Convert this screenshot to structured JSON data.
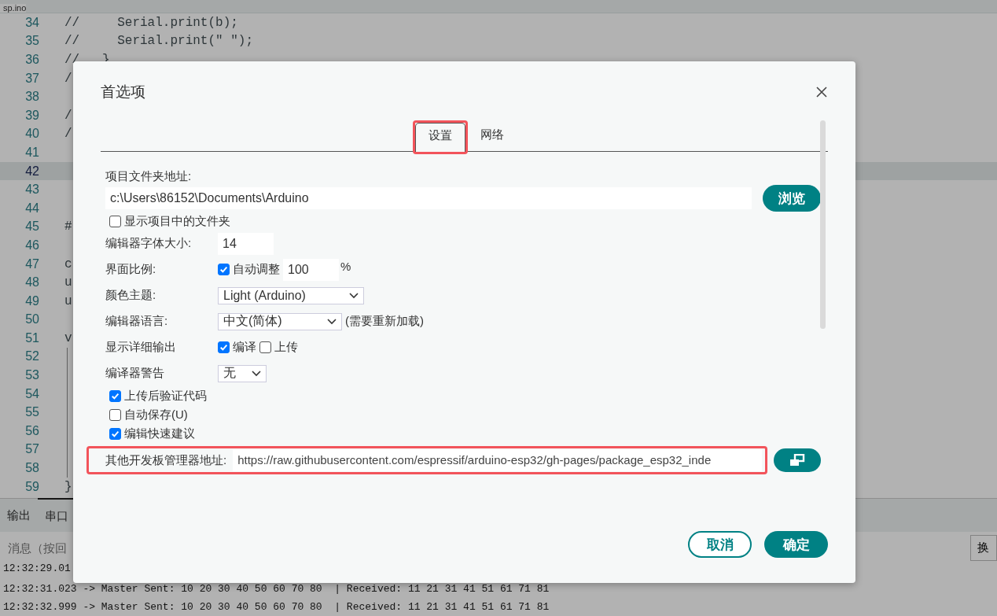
{
  "editor": {
    "file_tab": "sp.ino",
    "lines": [
      {
        "number": "34",
        "code": "//     Serial.print(b);",
        "current": false,
        "guide": false
      },
      {
        "number": "35",
        "code": "//     Serial.print(\" \");",
        "current": false,
        "guide": false
      },
      {
        "number": "36",
        "code": "//   }",
        "current": false,
        "guide": false
      },
      {
        "number": "37",
        "code": "/",
        "current": false,
        "guide": false
      },
      {
        "number": "38",
        "current": false,
        "guide": false
      },
      {
        "number": "39",
        "code": "/",
        "current": false,
        "guide": false
      },
      {
        "number": "40",
        "code": "/",
        "current": false,
        "guide": false
      },
      {
        "number": "41",
        "current": false,
        "guide": false
      },
      {
        "number": "42",
        "current": true,
        "guide": false
      },
      {
        "number": "43",
        "current": false,
        "guide": false
      },
      {
        "number": "44",
        "current": false,
        "guide": false
      },
      {
        "number": "45",
        "code": "#",
        "current": false,
        "guide": false
      },
      {
        "number": "46",
        "current": false,
        "guide": false
      },
      {
        "number": "47",
        "code": "c",
        "current": false,
        "guide": false
      },
      {
        "number": "48",
        "code": "u",
        "current": false,
        "guide": false
      },
      {
        "number": "49",
        "code": "u",
        "current": false,
        "guide": false
      },
      {
        "number": "50",
        "current": false,
        "guide": false
      },
      {
        "number": "51",
        "code": "v",
        "current": false,
        "guide": false
      },
      {
        "number": "52",
        "current": false,
        "guide": true
      },
      {
        "number": "53",
        "current": false,
        "guide": true
      },
      {
        "number": "54",
        "current": false,
        "guide": true
      },
      {
        "number": "55",
        "current": false,
        "guide": true
      },
      {
        "number": "56",
        "current": false,
        "guide": true
      },
      {
        "number": "57",
        "current": false,
        "guide": true
      },
      {
        "number": "58",
        "current": false,
        "guide": true
      },
      {
        "number": "59",
        "code": "}",
        "current": false,
        "guide": false
      }
    ]
  },
  "bottom_panel": {
    "tabs": [
      {
        "label": "输出",
        "selected": false
      },
      {
        "label": "串口",
        "selected": true
      }
    ],
    "message_field": {
      "placeholder": "消息（按回"
    },
    "line_ending": "换",
    "console": [
      "12:32:29.01",
      "12:32:31.023 -> Master Sent: 10 20 30 40 50 60 70 80  | Received: 11 21 31 41 51 61 71 81",
      "12:32:32.999 -> Master Sent: 10 20 30 40 50 60 70 80  | Received: 11 21 31 41 51 61 71 81"
    ]
  },
  "dialog": {
    "title": "首选项",
    "tabs": [
      {
        "label": "设置",
        "selected": true,
        "highlighted": true
      },
      {
        "label": "网络",
        "selected": false,
        "highlighted": false
      }
    ],
    "sketchbook": {
      "label": "项目文件夹地址:",
      "value": "c:\\Users\\86152\\Documents\\Arduino",
      "button": "浏览"
    },
    "show_files": {
      "label": "显示项目中的文件夹",
      "checked": false
    },
    "font_size": {
      "label": "编辑器字体大小:",
      "value": "14"
    },
    "scale": {
      "label": "界面比例:",
      "auto": {
        "label": "自动调整",
        "checked": true
      },
      "value": "100",
      "unit": "%"
    },
    "theme": {
      "label": "颜色主题:",
      "value": "Light (Arduino)"
    },
    "language": {
      "label": "编辑器语言:",
      "value": "中文(简体)",
      "note": "(需要重新加载)"
    },
    "verbose": {
      "label": "显示详细输出",
      "options": [
        {
          "label": "编译",
          "checked": true
        },
        {
          "label": "上传",
          "checked": false
        }
      ]
    },
    "warnings": {
      "label": "编译器警告",
      "value": "无"
    },
    "options": [
      {
        "label": "上传后验证代码",
        "checked": true
      },
      {
        "label": "自动保存(U)",
        "checked": false
      },
      {
        "label": "编辑快速建议",
        "checked": true
      }
    ],
    "board_urls": {
      "label": "其他开发板管理器地址:",
      "value": "https://raw.githubusercontent.com/espressif/arduino-esp32/gh-pages/package_esp32_inde",
      "highlighted": true
    },
    "buttons": [
      {
        "label": "取消",
        "kind": "secondary"
      },
      {
        "label": "确定",
        "kind": "primary"
      }
    ]
  }
}
